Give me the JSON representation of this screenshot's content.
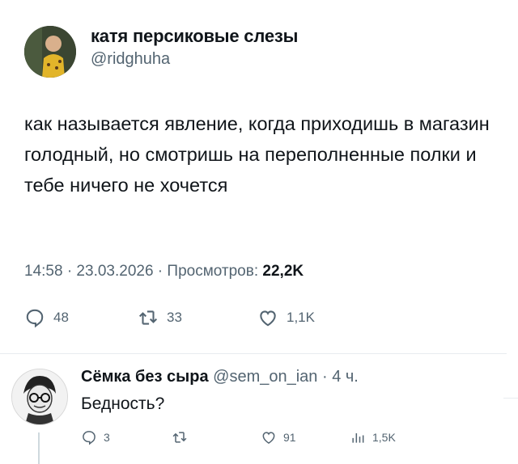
{
  "tweet": {
    "author_name": "катя персиковые слезы",
    "author_handle": "@ridghuha",
    "text": "как называется явление, когда приходишь в магазин голодный, но смотришь на переполненные полки и тебе ничего не хочется",
    "meta_prefix": "14:58 · 23.03.2026 · Просмотров: ",
    "views": "22,2K",
    "actions": {
      "replies": "48",
      "retweets": "33",
      "likes": "1,1K"
    }
  },
  "reply": {
    "author_name": "Сёмка без сыра",
    "author_handle": "@sem_on_ian",
    "time": "· 4 ч.",
    "text": "Бедность?",
    "actions": {
      "replies": "3",
      "retweets": "",
      "likes": "91",
      "views": "1,5K"
    }
  },
  "icons": {
    "reply": "speech-bubble-icon",
    "retweet": "retweet-icon",
    "like": "heart-icon",
    "views": "bar-chart-icon"
  }
}
